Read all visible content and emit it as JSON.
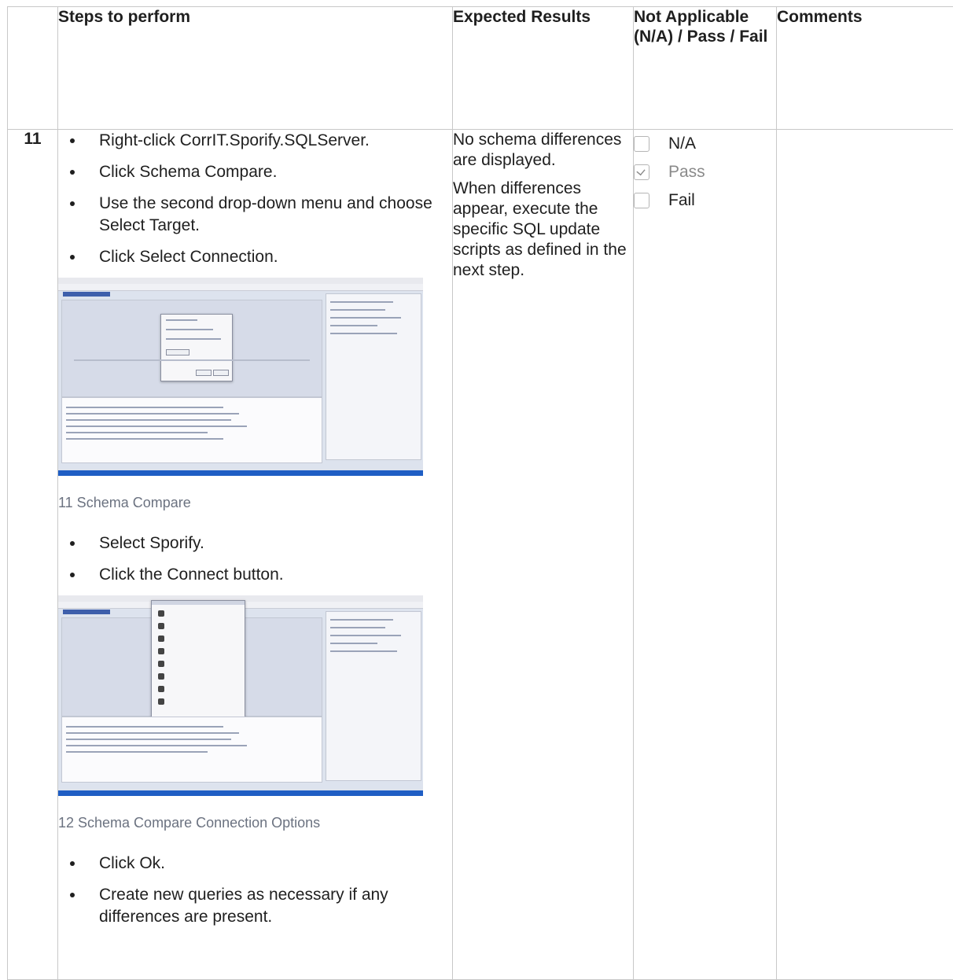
{
  "headers": {
    "num": "",
    "steps": "Steps to perform",
    "expected": "Expected Results",
    "status": "Not Applicable (N/A) / Pass / Fail",
    "comments": "Comments"
  },
  "row": {
    "number": "11",
    "steps_group1": [
      "Right-click CorrIT.Sporify.SQLServer.",
      "Click Schema Compare.",
      "Use the second drop-down menu and choose Select Target.",
      "Click Select Connection."
    ],
    "caption1": "11 Schema Compare",
    "steps_group2": [
      "Select Sporify.",
      "Click the Connect button."
    ],
    "caption2": "12 Schema Compare Connection Options",
    "steps_group3": [
      "Click Ok.",
      "Create new queries as necessary if any differences are present."
    ],
    "expected": [
      "No schema differences are displayed.",
      "When differences appear, execute the specific SQL update scripts as defined in the next step."
    ],
    "status_options": [
      {
        "label": "N/A",
        "checked": false
      },
      {
        "label": "Pass",
        "checked": true
      },
      {
        "label": "Fail",
        "checked": false
      }
    ],
    "comments": ""
  },
  "colors": {
    "border": "#c8c8c8",
    "caption": "#6b7280",
    "ide_accent": "#1f5ec4"
  }
}
